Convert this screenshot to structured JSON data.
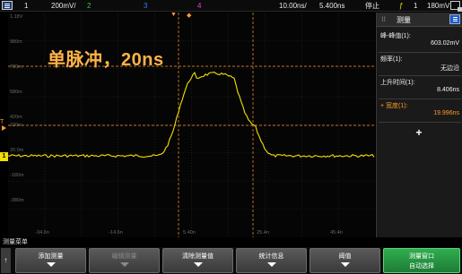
{
  "status_bar": {
    "ch1": "1",
    "ch1_scale": "200mV/",
    "ch2": "2",
    "ch3": "3",
    "ch4": "4",
    "timebase": "10.00ns/",
    "delay": "5.400ns",
    "run_state": "停止",
    "trigger_source": "1",
    "trigger_level": "180mV"
  },
  "colors": {
    "ch1": "#f2e100",
    "ch2": "#33cc33",
    "ch3": "#3a7bff",
    "ch4": "#e040e0",
    "cursor": "#ff9a2a",
    "overlay_text": "#ffb347"
  },
  "overlay_title": "单脉冲，20ns",
  "y_axis_labels": [
    "1.18V",
    "980m",
    "780m",
    "580m",
    "420m",
    "220m",
    "20.0m",
    "-180m",
    "-380m"
  ],
  "x_axis_labels": [
    "-34.6n",
    "-14.6n",
    "5.40n",
    "25.4n",
    "45.4n"
  ],
  "markers": {
    "time_ref": "T",
    "ch1": "1"
  },
  "panel": {
    "dots": "⁝⁝",
    "title": "测量",
    "measurements": [
      {
        "name": "峰-峰值(1):",
        "value": "603.02mV",
        "highlight": false
      },
      {
        "name": "频率(1):",
        "value": "无边沿",
        "highlight": false
      },
      {
        "name": "上升时间(1):",
        "value": "8.406ns",
        "highlight": false
      },
      {
        "name": "+ 宽度(1):",
        "value": "19.996ns",
        "highlight": true
      }
    ],
    "add_symbol": "+"
  },
  "softkeys": {
    "menu_label": "测量菜单",
    "back": "↑",
    "keys": [
      {
        "label": "添加测量",
        "disabled": false
      },
      {
        "label": "编辑测量",
        "disabled": true
      },
      {
        "label": "清除测量值",
        "disabled": false
      },
      {
        "label": "统计信息",
        "disabled": false
      },
      {
        "label": "阈值",
        "disabled": false
      },
      {
        "label": "测量窗口",
        "sub": "自动选择",
        "green": true
      }
    ]
  }
}
